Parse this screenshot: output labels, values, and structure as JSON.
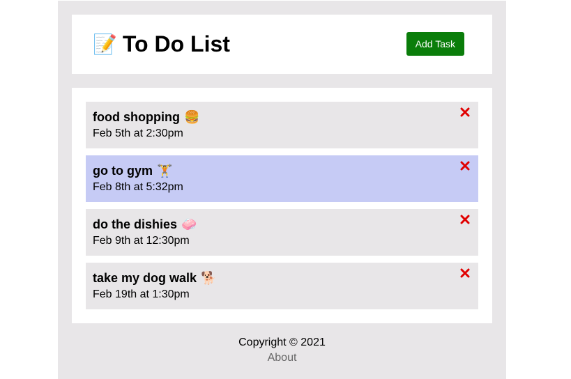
{
  "header": {
    "icon": "memo-icon",
    "icon_glyph": "📝",
    "title": "To Do List",
    "add_button_label": "Add Task",
    "add_button_color": "#0a7d0a"
  },
  "tasks": [
    {
      "title": "food shopping",
      "emoji": "🍔",
      "date": "Feb 5th at 2:30pm",
      "highlighted": false
    },
    {
      "title": "go to gym",
      "emoji": "🏋️",
      "date": "Feb 8th at 5:32pm",
      "highlighted": true
    },
    {
      "title": "do the dishies",
      "emoji": "🧼",
      "date": "Feb 9th at 12:30pm",
      "highlighted": false
    },
    {
      "title": "take my dog walk",
      "emoji": "🐕",
      "date": "Feb 19th at 1:30pm",
      "highlighted": false
    }
  ],
  "colors": {
    "highlight": "#c6cbf5",
    "task_bg": "#e8e6e8",
    "delete": "#e00000"
  },
  "footer": {
    "copyright": "Copyright © 2021",
    "about_link": "About"
  }
}
